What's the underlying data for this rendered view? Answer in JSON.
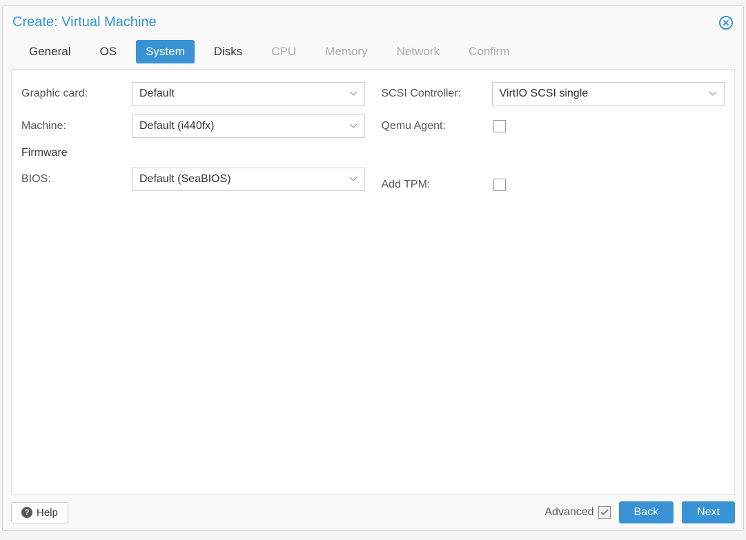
{
  "dialog": {
    "title": "Create: Virtual Machine"
  },
  "tabs": {
    "general": "General",
    "os": "OS",
    "system": "System",
    "disks": "Disks",
    "cpu": "CPU",
    "memory": "Memory",
    "network": "Network",
    "confirm": "Confirm"
  },
  "labels": {
    "graphic_card": "Graphic card:",
    "machine": "Machine:",
    "firmware": "Firmware",
    "bios": "BIOS:",
    "scsi_controller": "SCSI Controller:",
    "qemu_agent": "Qemu Agent:",
    "add_tpm": "Add TPM:"
  },
  "values": {
    "graphic_card": "Default",
    "machine": "Default (i440fx)",
    "bios": "Default (SeaBIOS)",
    "scsi_controller": "VirtIO SCSI single"
  },
  "footer": {
    "help": "Help",
    "advanced": "Advanced",
    "back": "Back",
    "next": "Next"
  }
}
